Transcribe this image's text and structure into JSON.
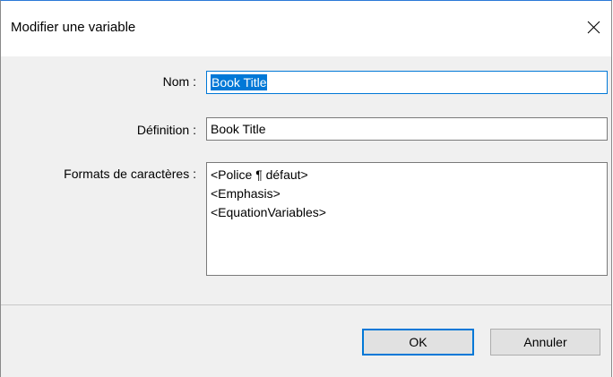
{
  "dialog": {
    "title": "Modifier une variable",
    "close_icon": "close-icon"
  },
  "form": {
    "name_label": "Nom :",
    "name_value": "Book Title",
    "definition_label": "Définition :",
    "definition_value": "Book Title",
    "formats_label": "Formats de caractères :",
    "formats": [
      "<Police ¶ défaut>",
      "<Emphasis>",
      "<EquationVariables>"
    ]
  },
  "buttons": {
    "ok_label": "OK",
    "cancel_label": "Annuler"
  },
  "colors": {
    "accent": "#0078d7",
    "dialog_body": "#f0f0f0",
    "button_face": "#e1e1e1"
  }
}
